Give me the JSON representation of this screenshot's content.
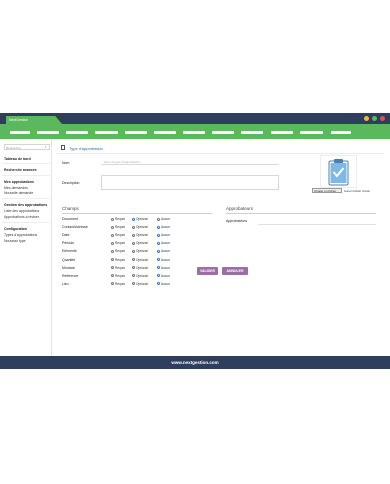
{
  "window": {
    "tab_label": "NextGestion",
    "dot_colors": [
      "#f5b731",
      "#5cb85c",
      "#e0524f"
    ]
  },
  "sidebar": {
    "search_placeholder": "Recherche",
    "items": [
      {
        "label": "Tableau de bord",
        "type": "heading"
      },
      {
        "label": "Recherche avancée",
        "type": "heading"
      },
      {
        "label": "Mes approbations",
        "type": "heading"
      },
      {
        "label": "Mes demandes",
        "type": "item"
      },
      {
        "label": "Nouvelle demande",
        "type": "item"
      },
      {
        "label": "Gestion des approbations",
        "type": "heading"
      },
      {
        "label": "Liste des approbations",
        "type": "item"
      },
      {
        "label": "Approbations à réviser",
        "type": "item"
      },
      {
        "label": "Configuration",
        "type": "heading"
      },
      {
        "label": "Types d'approbations",
        "type": "item"
      },
      {
        "label": "Nouveau type",
        "type": "item"
      }
    ]
  },
  "breadcrumb": {
    "label": "Type d'approbation"
  },
  "form": {
    "nom_label": "Nom",
    "nom_placeholder": "Nom du type d'approbation",
    "description_label": "Description",
    "file_button": "Choisir un fichier",
    "file_none": "Aucun fichier choisi"
  },
  "champs": {
    "title": "Champs",
    "options": [
      "Requis",
      "Optional",
      "Aucun"
    ],
    "rows": [
      {
        "name": "Document",
        "selected": 1
      },
      {
        "name": "Contact/Adresse",
        "selected": 2
      },
      {
        "name": "Date",
        "selected": 2
      },
      {
        "name": "Période",
        "selected": 2
      },
      {
        "name": "Eléments",
        "selected": 2
      },
      {
        "name": "Quantité",
        "selected": 2
      },
      {
        "name": "Montant",
        "selected": 2
      },
      {
        "name": "Référence",
        "selected": 2
      },
      {
        "name": "Lieu",
        "selected": 2
      }
    ]
  },
  "approbateurs": {
    "title": "Approbateurs",
    "field_label": "Approbateurs"
  },
  "actions": {
    "validate": "VALIDER",
    "cancel": "ANNULER"
  },
  "footer": {
    "text": "www.nextgestion.com"
  },
  "colors": {
    "topbar": "#2f3e5c",
    "nav": "#5cb85c",
    "button": "#9b6fa3",
    "link": "#2a6f91"
  }
}
